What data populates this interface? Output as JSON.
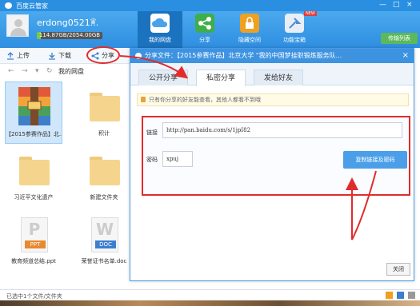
{
  "window": {
    "title": "百度云管家",
    "controls": [
      "—",
      "□",
      "×"
    ]
  },
  "user": {
    "name": "erdong0521...",
    "quota_text": "114.87GB/2054.00GB",
    "quota_fraction": 0.056
  },
  "nav": {
    "tabs": [
      {
        "label": "我的网盘",
        "icon": "cloud-icon",
        "active": true
      },
      {
        "label": "分享",
        "icon": "share-icon",
        "active": false
      },
      {
        "label": "隐藏空间",
        "icon": "lock-icon",
        "active": false
      },
      {
        "label": "功能宝箱",
        "icon": "toolbox-icon",
        "active": false
      }
    ],
    "new_badge": "NEW",
    "transfer_label": "传输列表"
  },
  "toolbar": {
    "upload": "上传",
    "download": "下载",
    "share": "分享"
  },
  "address": {
    "breadcrumb": "我的网盘"
  },
  "files": [
    {
      "name": "【2015参赛作品】北...",
      "kind": "archive"
    },
    {
      "name": "积计",
      "kind": "folder"
    },
    {
      "name": "习近平文化遗产",
      "kind": "folder"
    },
    {
      "name": "新建文件夹",
      "kind": "folder"
    },
    {
      "name": "教育频道总结.ppt",
      "kind": "ppt",
      "badge": "PPT"
    },
    {
      "name": "荣誉证书名单.doc",
      "kind": "doc",
      "badge": "DOC"
    }
  ],
  "status": {
    "text": "已选中1个文件/文件夹"
  },
  "dialog": {
    "title": "分享文件：【2015参赛作品】北京大学 \"我的中国梦挂职锻炼服务队...",
    "tabs": [
      "公开分享",
      "私密分享",
      "发给好友"
    ],
    "active_tab": 1,
    "notice": "只有你分享的好友能查看，其他人都看不到哦",
    "link_label": "链接",
    "link_value": "http://pan.baidu.com/s/1jpI82",
    "password_label": "密码",
    "password_value": "xpuj",
    "copy_button": "复制链接及密码",
    "close_button": "关闭"
  },
  "colors": {
    "accent": "#2a8fe0",
    "annotation": "#e22b2b"
  }
}
